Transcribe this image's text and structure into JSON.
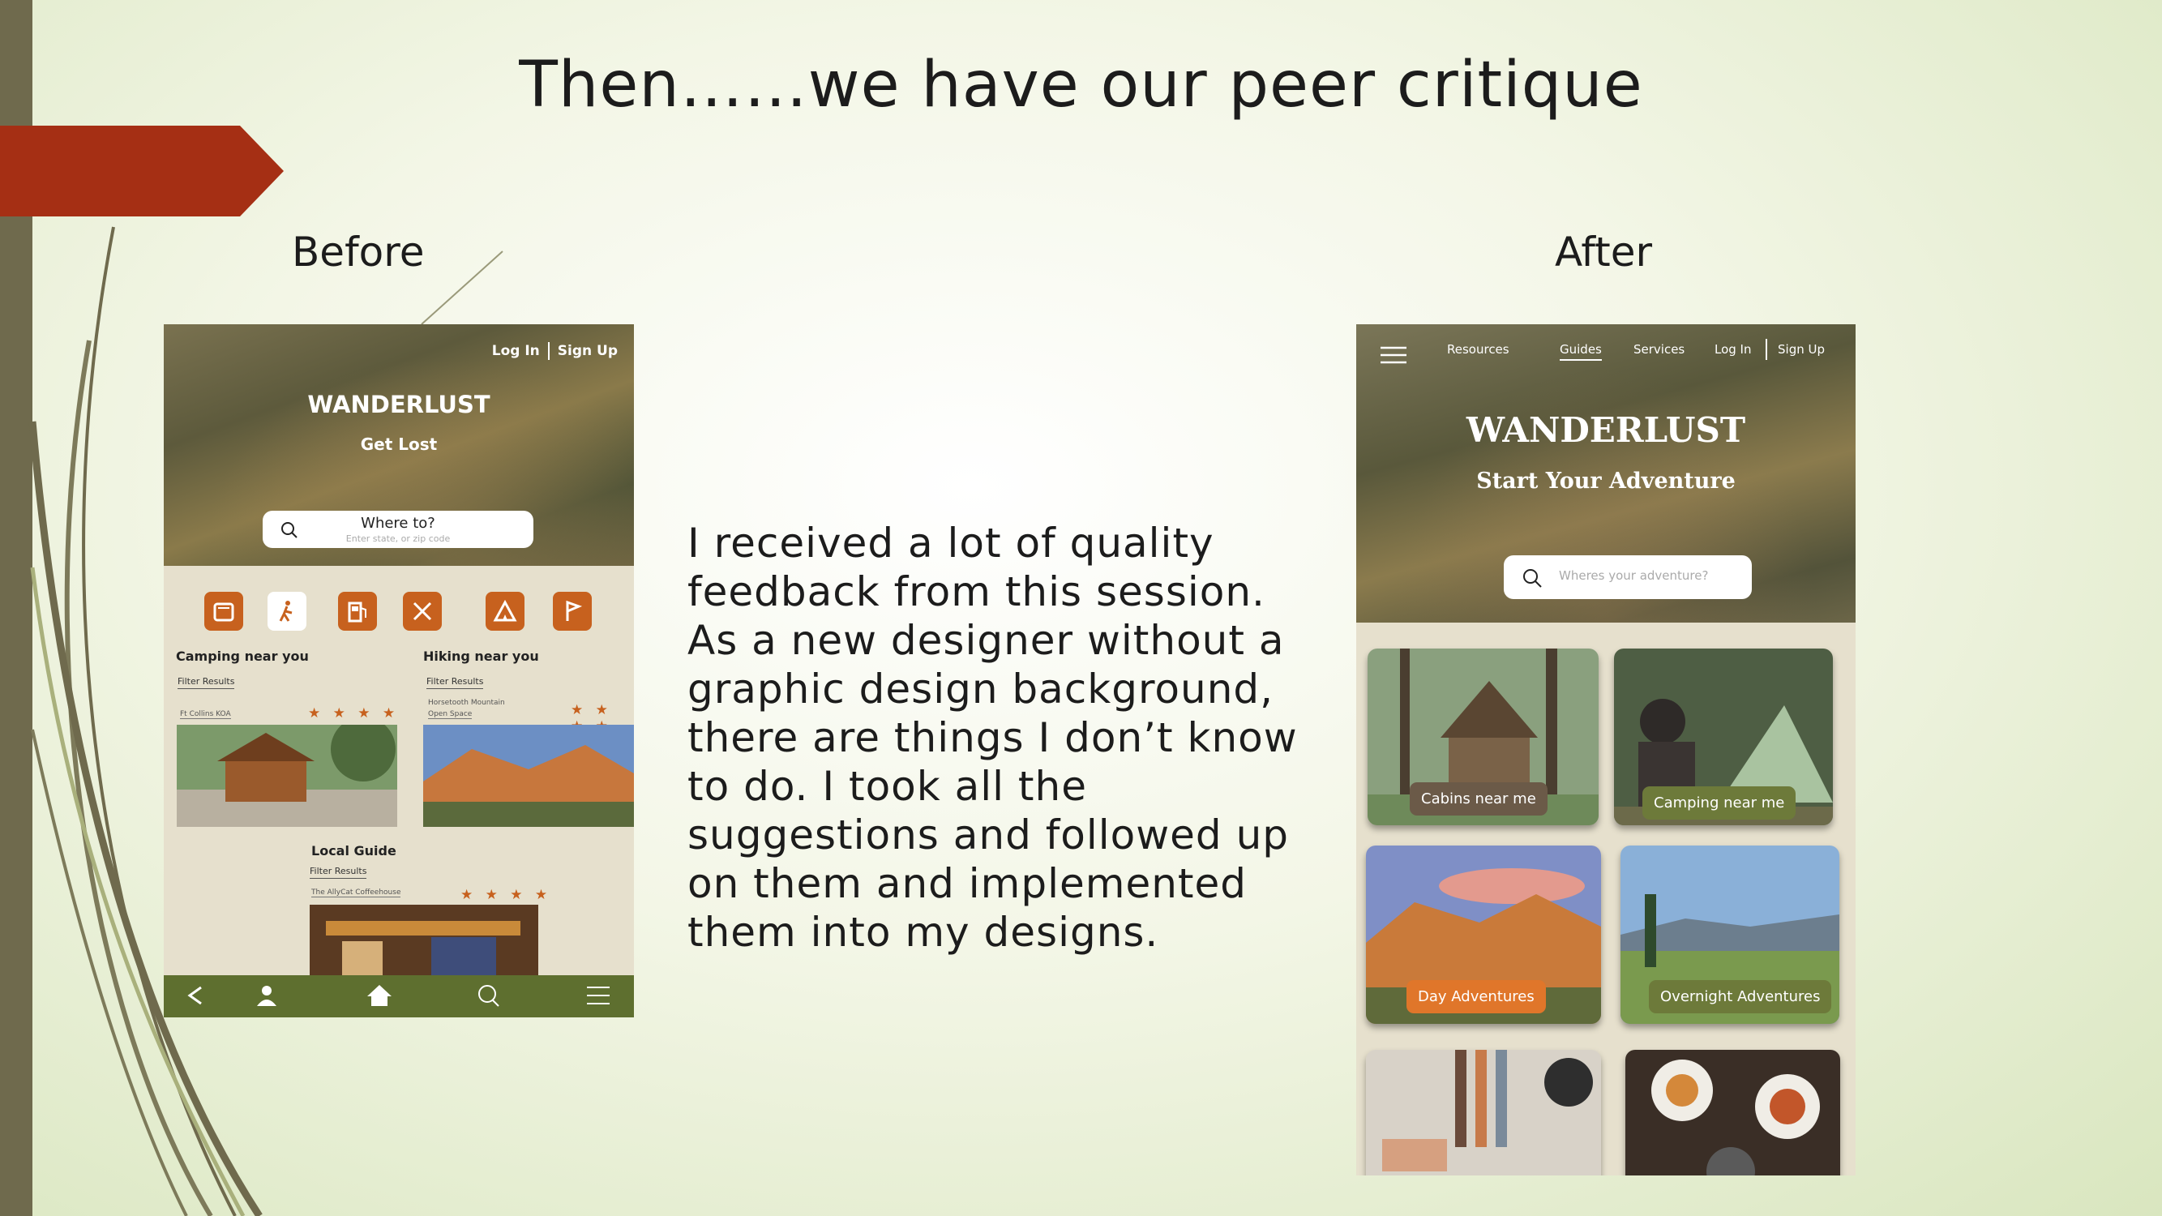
{
  "slide": {
    "title": "Then……we have our peer critique",
    "before_label": "Before",
    "after_label": "After",
    "body_text": "I received a lot of quality feedback from this session. As a new designer without a graphic design background, there are things I don’t know to do. I took all the suggestions and followed up on them and implemented them into my designs."
  },
  "before": {
    "auth": {
      "login": "Log In",
      "signup": "Sign Up"
    },
    "brand": "WANDERLUST",
    "tagline": "Get Lost",
    "search": {
      "placeholder": "Where to?",
      "sub": "Enter state, or zip code"
    },
    "categories": [
      "stove-icon",
      "hiking-icon",
      "fuel-icon",
      "utensils-icon",
      "tent-icon",
      "flag-icon"
    ],
    "camping": {
      "title": "Camping near you",
      "filter": "Filter Results",
      "place": "Ft Collins KOA"
    },
    "hiking": {
      "title": "Hiking near you",
      "filter": "Filter Results",
      "place_line1": "Horsetooth Mountain",
      "place_line2": "Open Space"
    },
    "guide": {
      "title": "Local Guide",
      "filter": "Filter Results",
      "place": "The AllyCat Coffeehouse"
    },
    "stars": "★ ★ ★ ★",
    "nav": [
      "back-icon",
      "profile-icon",
      "home-icon",
      "search-icon",
      "menu-icon"
    ],
    "colors": {
      "accent": "#c7611e",
      "nav": "#5e6f2f"
    }
  },
  "after": {
    "nav": {
      "resources": "Resources",
      "guides": "Guides",
      "services": "Services",
      "login": "Log In",
      "signup": "Sign Up"
    },
    "brand": "WANDERLUST",
    "tagline": "Start Your Adventure",
    "search_placeholder": "Wheres your adventure?",
    "cards": {
      "cabins": "Cabins near me",
      "camping": "Camping near me",
      "day": "Day Adventures",
      "overnight": "Overnight Adventures"
    },
    "colors": {
      "brown": "#6b5a48",
      "green": "#6d7a3a",
      "orange": "#e0762a"
    }
  },
  "decor": {
    "arrow_color": "#a52f14",
    "bar_color": "#6f6a4d"
  }
}
